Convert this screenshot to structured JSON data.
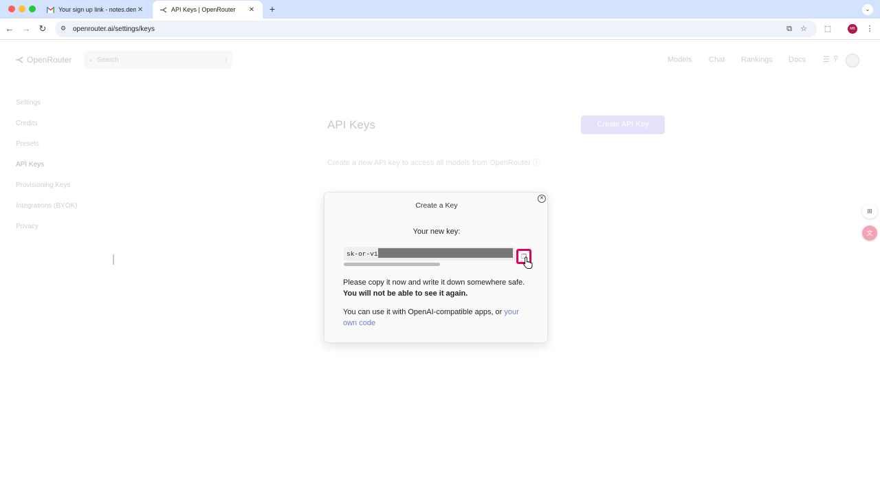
{
  "browser": {
    "tabs": [
      {
        "title": "Your sign up link - notes.dem"
      },
      {
        "title": "API Keys | OpenRouter"
      }
    ],
    "url": "openrouter.ai/settings/keys",
    "profile_initials": "MB"
  },
  "header": {
    "logo_text": "OpenRouter",
    "search_placeholder": "Search",
    "search_shortcut": "/",
    "nav": [
      "Models",
      "Chat",
      "Rankings",
      "Docs"
    ]
  },
  "sidebar": {
    "items": [
      {
        "label": "Settings"
      },
      {
        "label": "Credits"
      },
      {
        "label": "Presets"
      },
      {
        "label": "API Keys"
      },
      {
        "label": "Provisioning Keys"
      },
      {
        "label": "Integrations (BYOK)"
      },
      {
        "label": "Privacy"
      }
    ]
  },
  "main": {
    "title": "API Keys",
    "create_button": "Create API Key",
    "subtitle": "Create a new API key to access all models from OpenRouter"
  },
  "modal": {
    "title": "Create a Key",
    "new_key_label": "Your new key:",
    "key_prefix": "sk-or-v1",
    "warning_text": "Please copy it now and write it down somewhere safe.",
    "warning_bold": "You will not be able to see it again.",
    "usage_text": "You can use it with OpenAI-compatible apps, or",
    "usage_link": "your own code"
  },
  "colors": {
    "accent": "#e6005c",
    "link": "#6f7fce",
    "create_button_bg": "#e4e1fa"
  }
}
